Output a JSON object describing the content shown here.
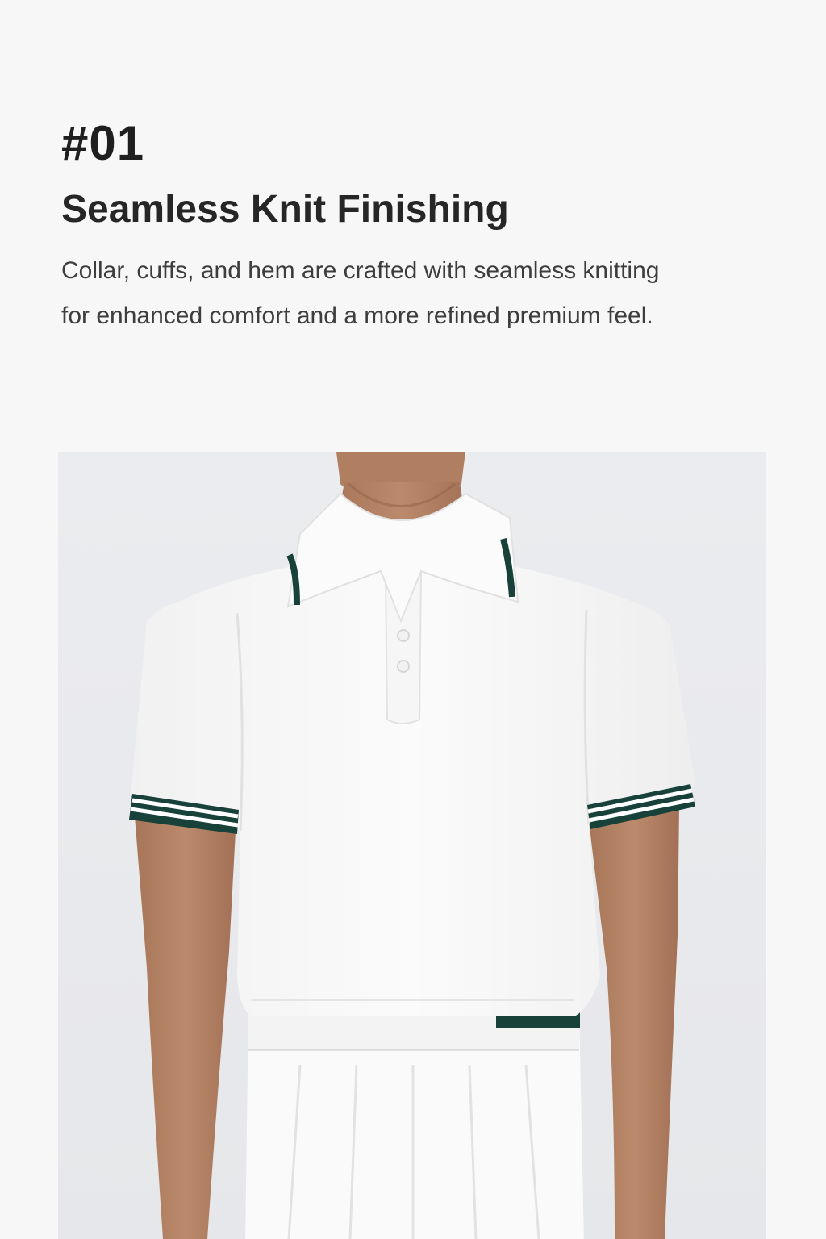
{
  "feature": {
    "number": "#01",
    "title": "Seamless Knit Finishing",
    "description": "Collar, cuffs, and hem are crafted with seamless knitting for enhanced comfort and a more refined premium feel."
  },
  "photo": {
    "subject": "white polo shirt with dark green striped collar and cuffs, worn with white pleated skirt",
    "colors": {
      "background": "#ecedef",
      "garment": "#fbfbfb",
      "trim": "#18413a",
      "skin": "#b58468"
    }
  }
}
